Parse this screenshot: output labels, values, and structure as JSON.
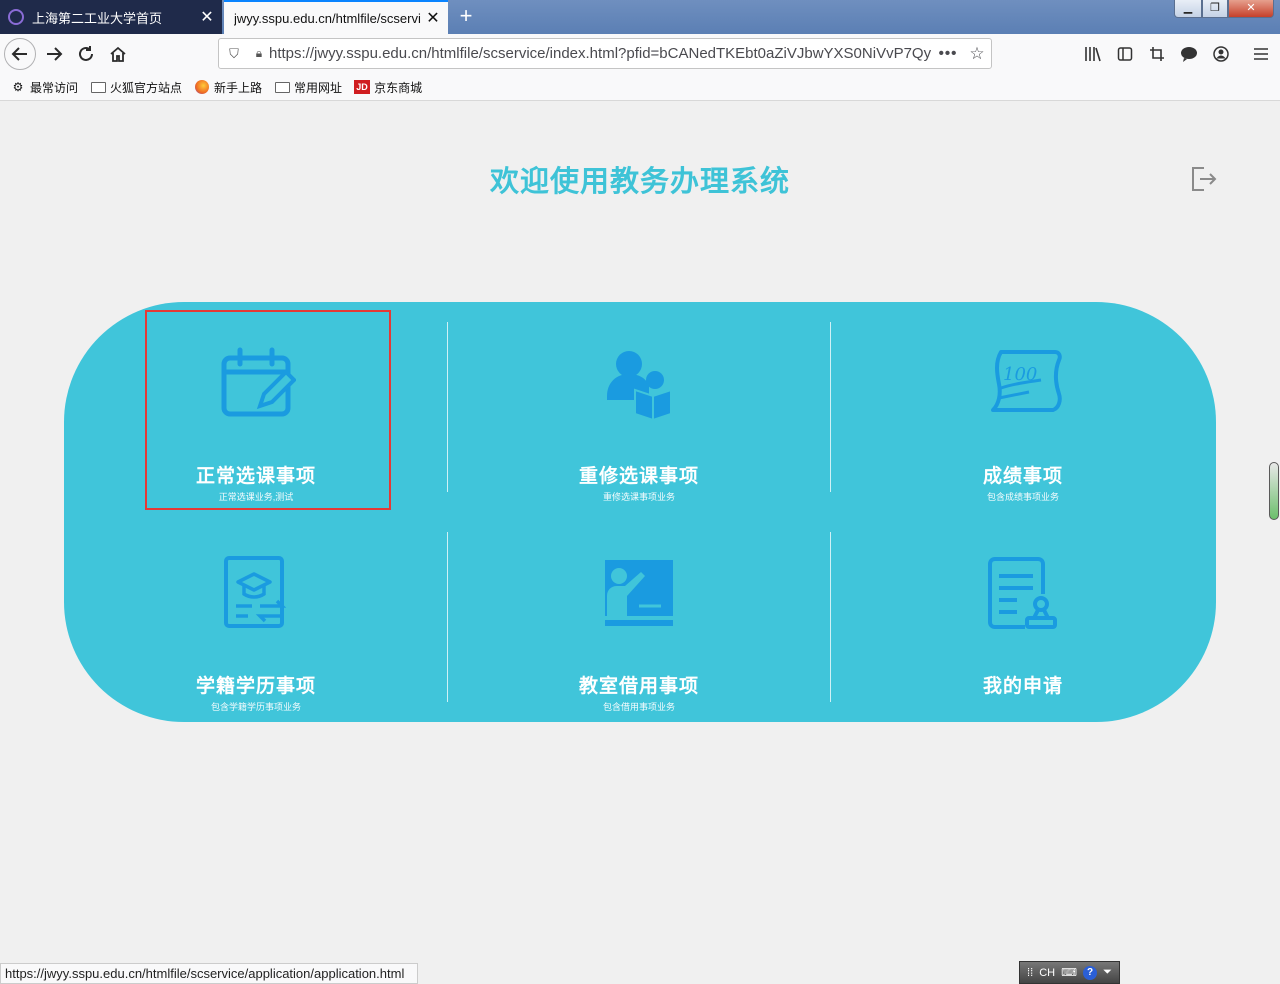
{
  "browser": {
    "tabs": [
      {
        "title": "上海第二工业大学首页",
        "active": false
      },
      {
        "title": "jwyy.sspu.edu.cn/htmlfile/scservi",
        "active": true
      }
    ],
    "new_tab": "+",
    "url": "https://jwyy.sspu.edu.cn/htmlfile/scservice/index.html?pfid=bCANedTKEbt0aZiVJbwYXS0NiVvP7Qy",
    "url_more": "•••",
    "bookmarks": [
      "最常访问",
      "火狐官方站点",
      "新手上路",
      "常用网址",
      "京东商城"
    ],
    "jd_logo": "JD",
    "status_url": "https://jwyy.sspu.edu.cn/htmlfile/scservice/application/application.html",
    "ime_label": "CH",
    "ime_help": "?"
  },
  "page": {
    "title": "欢迎使用教务办理系统",
    "items": [
      {
        "name": "正常选课事项",
        "desc": "正常选课业务,测试",
        "icon": "calendar-edit-icon"
      },
      {
        "name": "重修选课事项",
        "desc": "重修选课事项业务",
        "icon": "student-reading-icon"
      },
      {
        "name": "成绩事项",
        "desc": "包含成绩事项业务",
        "icon": "score-paper-icon"
      },
      {
        "name": "学籍学历事项",
        "desc": "包含学籍学历事项业务",
        "icon": "graduation-certificate-icon"
      },
      {
        "name": "教室借用事项",
        "desc": "包含借用事项业务",
        "icon": "classroom-teacher-icon"
      },
      {
        "name": "我的申请",
        "desc": "",
        "icon": "application-stamp-icon"
      }
    ]
  },
  "colors": {
    "panel": "#40c5da",
    "title": "#3ec3d7",
    "icon": "#1a9be0",
    "highlight": "#e53935"
  }
}
